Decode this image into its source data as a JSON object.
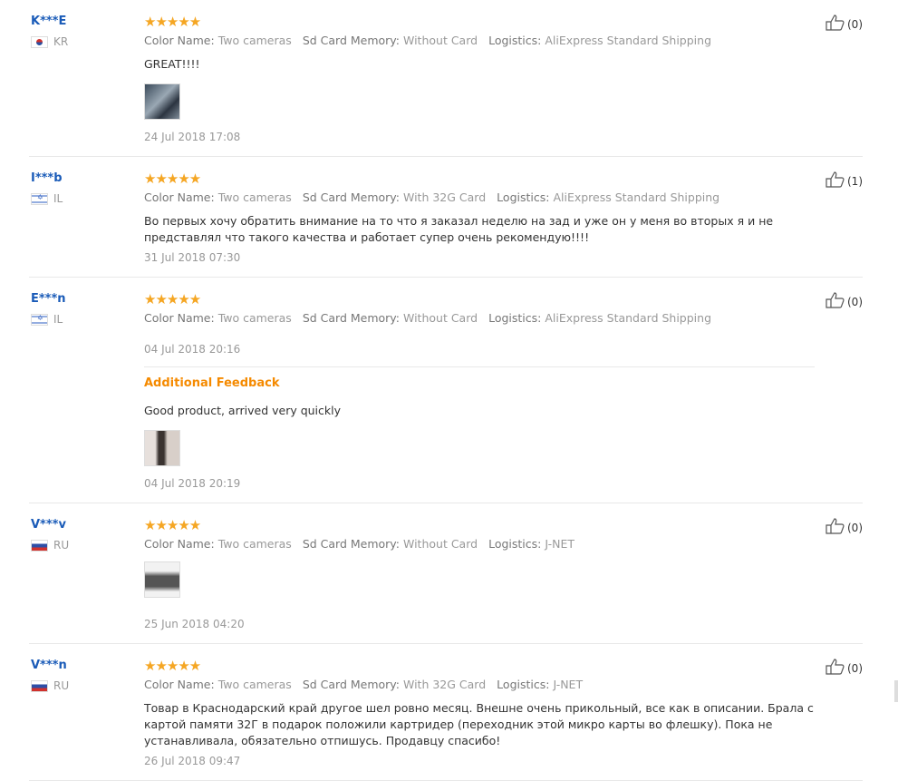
{
  "labels": {
    "color_key": "Color Name:",
    "sd_key": "Sd Card Memory:",
    "log_key": "Logistics:",
    "stars": "★★★★★",
    "additional_feedback": "Additional Feedback"
  },
  "reviews": [
    {
      "user": "K***E",
      "country": "KR",
      "flag_icon": "south-korea-flag-icon",
      "color": "Two cameras",
      "sd": "Without Card",
      "logistics": "AliExpress Standard Shipping",
      "text": "GREAT!!!!",
      "has_photo": true,
      "date": "24 Jul 2018 17:08",
      "likes": "(0)"
    },
    {
      "user": "I***b",
      "country": "IL",
      "flag_icon": "israel-flag-icon",
      "color": "Two cameras",
      "sd": "With 32G Card",
      "logistics": "AliExpress Standard Shipping",
      "text": "Во первых хочу обратить внимание на то что я заказал неделю на зад и уже он у меня во вторых я и не представлял что такого качества и работает супер очень рекомендую!!!!",
      "has_photo": false,
      "date": "31 Jul 2018 07:30",
      "likes": "(1)"
    },
    {
      "user": "E***n",
      "country": "IL",
      "flag_icon": "israel-flag-icon",
      "color": "Two cameras",
      "sd": "Without Card",
      "logistics": "AliExpress Standard Shipping",
      "text": "",
      "has_photo": false,
      "date": "04 Jul 2018 20:16",
      "likes": "(0)",
      "additional": {
        "text": "Good product, arrived very quickly",
        "date": "04 Jul 2018 20:19"
      }
    },
    {
      "user": "V***v",
      "country": "RU",
      "flag_icon": "russia-flag-icon",
      "color": "Two cameras",
      "sd": "Without Card",
      "logistics": "J-NET",
      "text": "",
      "has_photo": true,
      "date": "25 Jun 2018 04:20",
      "likes": "(0)"
    },
    {
      "user": "V***n",
      "country": "RU",
      "flag_icon": "russia-flag-icon",
      "color": "Two cameras",
      "sd": "With 32G Card",
      "logistics": "J-NET",
      "text": "Товар в Краснодарский край другое шел ровно месяц. Внешне очень прикольный, все как в описании. Брала с картой памяти 32Г в подарок положили картридер (переходник этой микро карты во флешку). Пока не устанавливала, обязательно отпишусь. Продавцу спасибо!",
      "has_photo": false,
      "date": "26 Jul 2018 09:47",
      "likes": "(0)"
    }
  ]
}
